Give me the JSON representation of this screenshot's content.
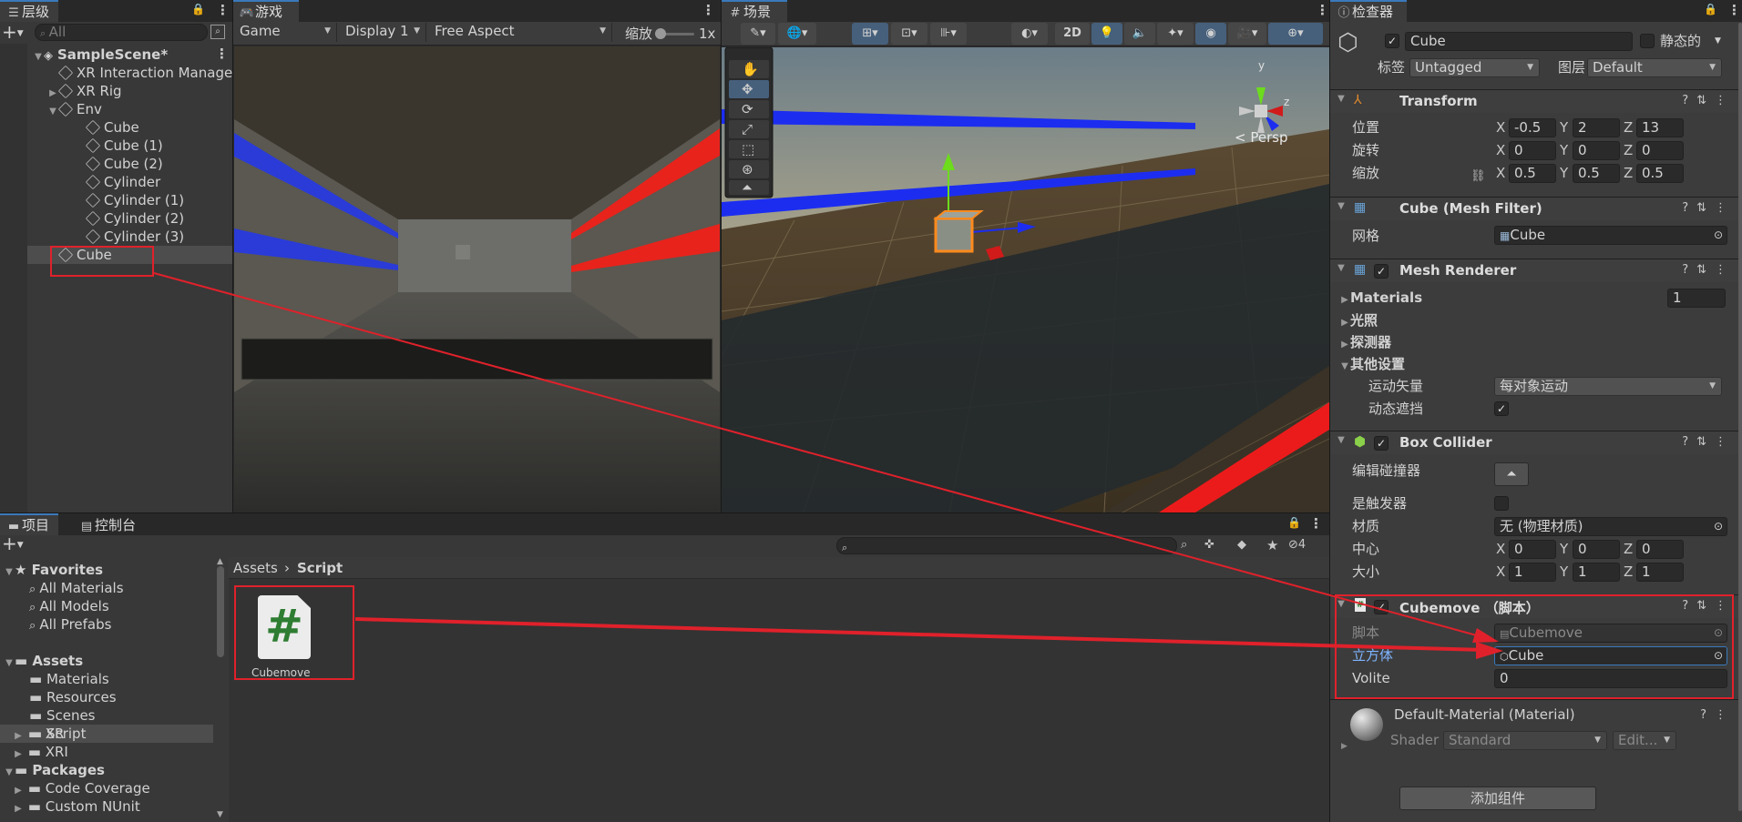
{
  "hierarchy": {
    "tab": "层级",
    "search_placeholder": "All",
    "scene": "SampleScene*",
    "items": [
      {
        "label": "XR Interaction Manager",
        "depth": 1,
        "arrow": ""
      },
      {
        "label": "XR Rig",
        "depth": 1,
        "arrow": "▶"
      },
      {
        "label": "Env",
        "depth": 1,
        "arrow": "▼"
      },
      {
        "label": "Cube",
        "depth": 2,
        "arrow": ""
      },
      {
        "label": "Cube (1)",
        "depth": 2,
        "arrow": ""
      },
      {
        "label": "Cube (2)",
        "depth": 2,
        "arrow": ""
      },
      {
        "label": "Cylinder",
        "depth": 2,
        "arrow": ""
      },
      {
        "label": "Cylinder (1)",
        "depth": 2,
        "arrow": ""
      },
      {
        "label": "Cylinder (2)",
        "depth": 2,
        "arrow": ""
      },
      {
        "label": "Cylinder (3)",
        "depth": 2,
        "arrow": ""
      },
      {
        "label": "Cube",
        "depth": 1,
        "arrow": "",
        "selected": true
      }
    ]
  },
  "game": {
    "tab": "游戏",
    "mode": "Game",
    "display": "Display 1",
    "aspect": "Free Aspect",
    "scale_label": "缩放",
    "scale_value": "1x"
  },
  "scene_view": {
    "tab": "场景",
    "btn_2d": "2D",
    "persp": "< Persp",
    "gizmo_y": "y",
    "gizmo_z": "z"
  },
  "inspector": {
    "tab": "检查器",
    "object_name": "Cube",
    "static_label": "静态的",
    "tag_label": "标签",
    "tag_value": "Untagged",
    "layer_label": "图层",
    "layer_value": "Default",
    "transform": {
      "title": "Transform",
      "rows": [
        {
          "label": "位置",
          "x": "-0.5",
          "y": "2",
          "z": "13"
        },
        {
          "label": "旋转",
          "x": "0",
          "y": "0",
          "z": "0"
        },
        {
          "label": "缩放",
          "x": "0.5",
          "y": "0.5",
          "z": "0.5"
        }
      ]
    },
    "mesh_filter": {
      "title": "Cube (Mesh Filter)",
      "mesh_label": "网格",
      "mesh_value": "Cube"
    },
    "mesh_renderer": {
      "title": "Mesh Renderer",
      "materials_label": "Materials",
      "materials_count": "1",
      "lighting": "光照",
      "probes": "探测器",
      "other": "其他设置",
      "motion_label": "运动矢量",
      "motion_value": "每对象运动",
      "dynamic_occlusion": "动态遮挡"
    },
    "box_collider": {
      "title": "Box Collider",
      "edit_label": "编辑碰撞器",
      "trigger_label": "是触发器",
      "material_label": "材质",
      "material_value": "无 (物理材质)",
      "center_label": "中心",
      "center": {
        "x": "0",
        "y": "0",
        "z": "0"
      },
      "size_label": "大小",
      "size": {
        "x": "1",
        "y": "1",
        "z": "1"
      }
    },
    "cubemove": {
      "title": "Cubemove （脚本）",
      "script_label": "脚本",
      "script_value": "Cubemove",
      "cube_label": "立方体",
      "cube_value": "Cube",
      "volite_label": "Volite",
      "volite_value": "0"
    },
    "material": {
      "title": "Default-Material (Material)",
      "shader_label": "Shader",
      "shader_value": "Standard",
      "edit_label": "Edit..."
    },
    "add_component": "添加组件"
  },
  "project": {
    "tab_project": "项目",
    "tab_console": "控制台",
    "favorites": "Favorites",
    "fav_items": [
      "All Materials",
      "All Models",
      "All Prefabs"
    ],
    "assets": "Assets",
    "asset_items": [
      "Materials",
      "Resources",
      "Scenes",
      "Script"
    ],
    "xr_items": [
      "XR",
      "XRI"
    ],
    "packages": "Packages",
    "package_items": [
      "Code Coverage",
      "Custom NUnit"
    ],
    "breadcrumb_root": "Assets",
    "breadcrumb_current": "Script",
    "file_name": "Cubemove",
    "hidden_count": "4"
  },
  "colors": {
    "accent": "#3a79bb",
    "annotation": "#e0212b",
    "script_icon": "#2e7d32"
  }
}
